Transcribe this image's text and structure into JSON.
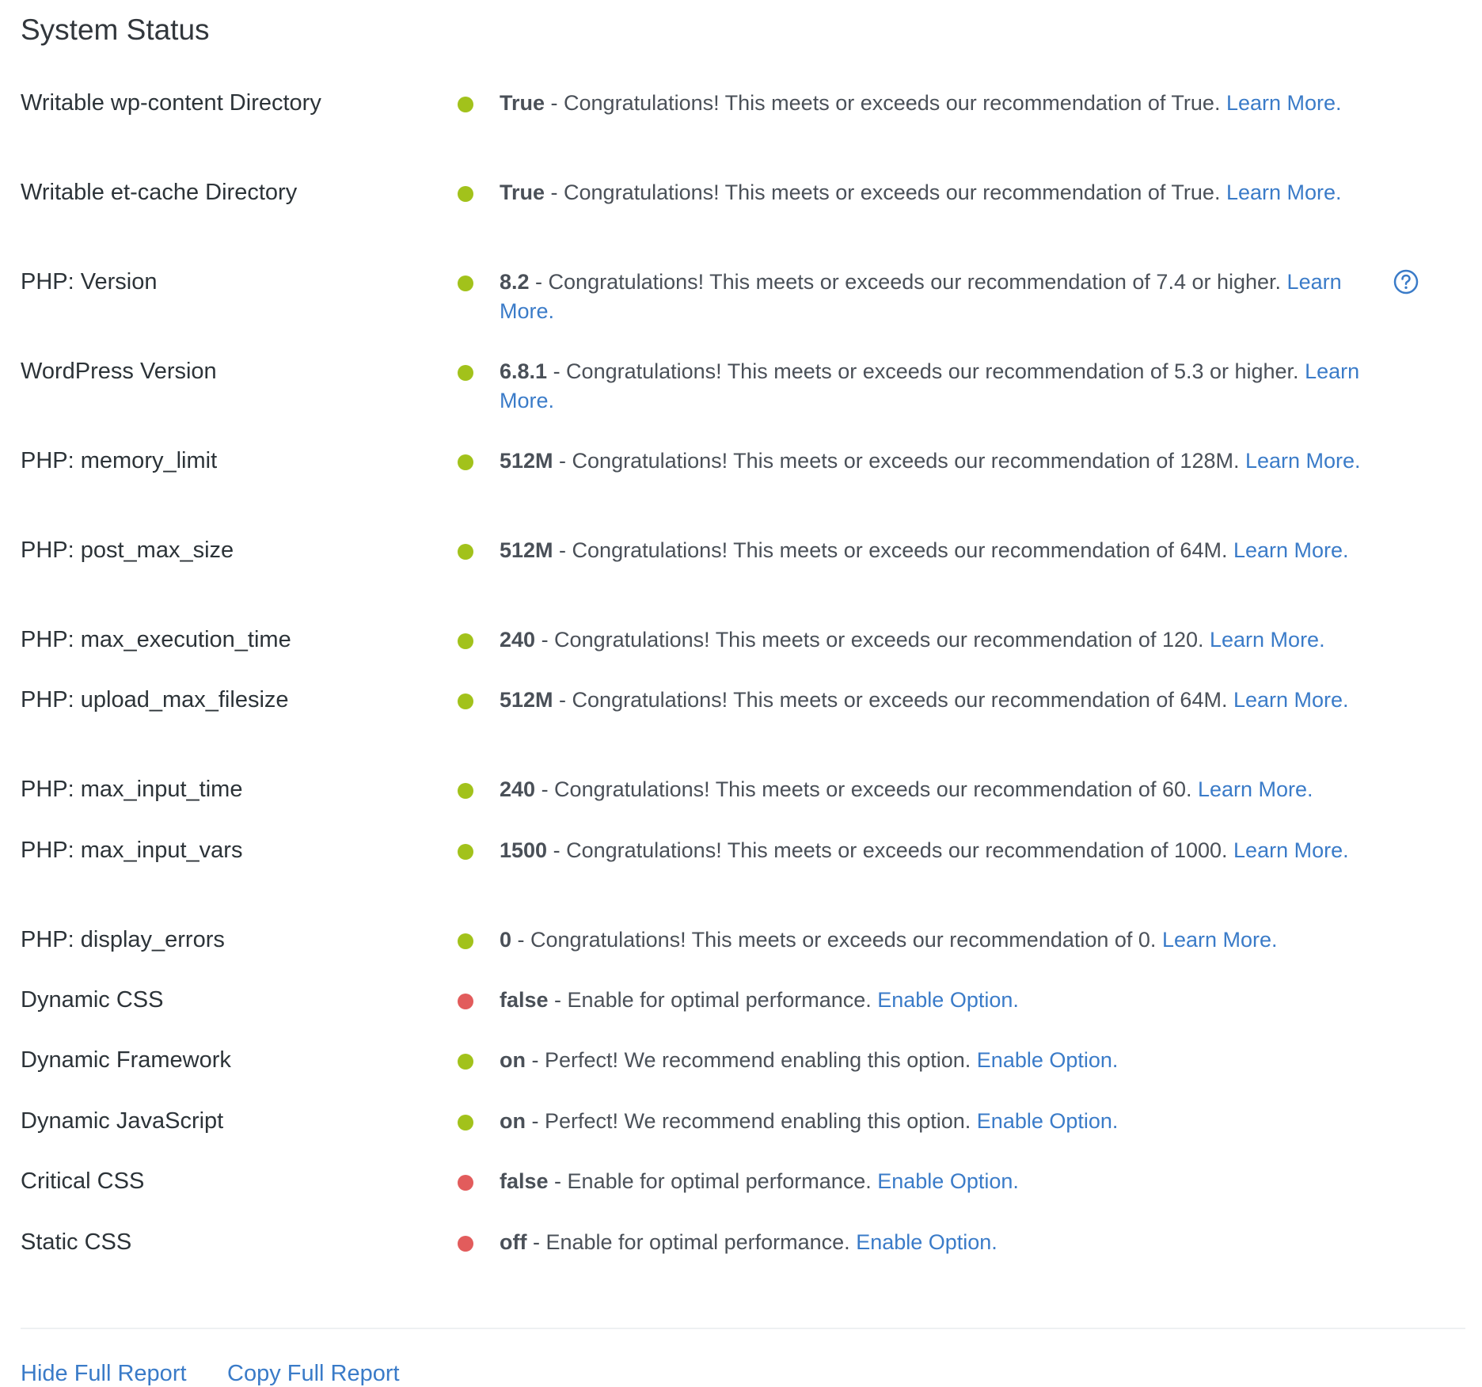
{
  "page_title": "System Status",
  "status_colors": {
    "ok": "#a2c21b",
    "bad": "#e25c5c",
    "link": "#3a7bc8"
  },
  "rows": [
    {
      "label": "Writable wp-content Directory",
      "status": "ok",
      "value": "True",
      "message": " - Congratulations! This meets or exceeds our recommendation of True. ",
      "link": "Learn More.",
      "help_icon": false
    },
    {
      "label": "Writable et-cache Directory",
      "status": "ok",
      "value": "True",
      "message": " - Congratulations! This meets or exceeds our recommendation of True. ",
      "link": "Learn More.",
      "help_icon": false
    },
    {
      "label": "PHP: Version",
      "status": "ok",
      "value": "8.2",
      "message": " - Congratulations! This meets or exceeds our recommendation of 7.4 or higher. ",
      "link": "Learn More.",
      "help_icon": true
    },
    {
      "label": "WordPress Version",
      "status": "ok",
      "value": "6.8.1",
      "message": " - Congratulations! This meets or exceeds our recommendation of 5.3 or higher. ",
      "link": "Learn More.",
      "help_icon": false
    },
    {
      "label": "PHP: memory_limit",
      "status": "ok",
      "value": "512M",
      "message": " - Congratulations! This meets or exceeds our recommendation of 128M. ",
      "link": "Learn More.",
      "help_icon": false
    },
    {
      "label": "PHP: post_max_size",
      "status": "ok",
      "value": "512M",
      "message": " - Congratulations! This meets or exceeds our recommendation of 64M. ",
      "link": "Learn More.",
      "help_icon": false
    },
    {
      "label": "PHP: max_execution_time",
      "status": "ok",
      "value": "240",
      "message": " - Congratulations! This meets or exceeds our recommendation of 120. ",
      "link": "Learn More.",
      "help_icon": false
    },
    {
      "label": "PHP: upload_max_filesize",
      "status": "ok",
      "value": "512M",
      "message": " - Congratulations! This meets or exceeds our recommendation of 64M. ",
      "link": "Learn More.",
      "help_icon": false
    },
    {
      "label": "PHP: max_input_time",
      "status": "ok",
      "value": "240",
      "message": " - Congratulations! This meets or exceeds our recommendation of 60. ",
      "link": "Learn More.",
      "help_icon": false
    },
    {
      "label": "PHP: max_input_vars",
      "status": "ok",
      "value": "1500",
      "message": " - Congratulations! This meets or exceeds our recommendation of 1000. ",
      "link": "Learn More.",
      "help_icon": false
    },
    {
      "label": "PHP: display_errors",
      "status": "ok",
      "value": "0",
      "message": " - Congratulations! This meets or exceeds our recommendation of 0. ",
      "link": "Learn More.",
      "help_icon": false
    },
    {
      "label": "Dynamic CSS",
      "status": "bad",
      "value": "false",
      "message": " - Enable for optimal performance. ",
      "link": "Enable Option.",
      "help_icon": false
    },
    {
      "label": "Dynamic Framework",
      "status": "ok",
      "value": "on",
      "message": " - Perfect! We recommend enabling this option. ",
      "link": "Enable Option.",
      "help_icon": false
    },
    {
      "label": "Dynamic JavaScript",
      "status": "ok",
      "value": "on",
      "message": " - Perfect! We recommend enabling this option. ",
      "link": "Enable Option.",
      "help_icon": false
    },
    {
      "label": "Critical CSS",
      "status": "bad",
      "value": "false",
      "message": " - Enable for optimal performance. ",
      "link": "Enable Option.",
      "help_icon": false
    },
    {
      "label": "Static CSS",
      "status": "bad",
      "value": "off",
      "message": " - Enable for optimal performance. ",
      "link": "Enable Option.",
      "help_icon": false
    }
  ],
  "footer": {
    "hide_report": "Hide Full Report",
    "copy_report": "Copy Full Report"
  }
}
